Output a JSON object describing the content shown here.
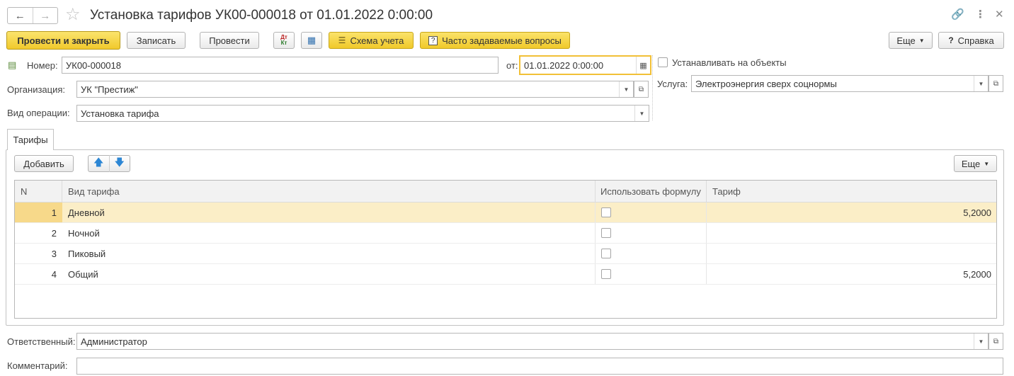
{
  "window": {
    "title": "Установка тарифов УК00-000018 от 01.01.2022 0:00:00"
  },
  "toolbar": {
    "post_close": "Провести и закрыть",
    "save": "Записать",
    "post": "Провести",
    "dt_kt_icon_label": "Дт Кт",
    "scheme": "Схема учета",
    "faq": "Часто задаваемые вопросы",
    "more": "Еще",
    "help": "Справка"
  },
  "form": {
    "number_label": "Номер:",
    "number_value": "УК00-000018",
    "date_label": "от:",
    "date_value": "01.01.2022  0:00:00",
    "org_label": "Организация:",
    "org_value": "УК \"Престиж\"",
    "op_label": "Вид операции:",
    "op_value": "Установка тарифа",
    "apply_objects_label": "Устанавливать на объекты",
    "service_label": "Услуга:",
    "service_value": "Электроэнергия сверх соцнормы",
    "responsible_label": "Ответственный:",
    "responsible_value": "Администратор",
    "comment_label": "Комментарий:",
    "comment_value": ""
  },
  "tabs": {
    "tariffs": "Тарифы"
  },
  "table_toolbar": {
    "add": "Добавить",
    "more": "Еще"
  },
  "table": {
    "headers": {
      "n": "N",
      "kind": "Вид тарифа",
      "formula": "Использовать формулу",
      "tariff": "Тариф"
    },
    "rows": [
      {
        "n": "1",
        "kind": "Дневной",
        "formula": false,
        "tariff": "5,2000"
      },
      {
        "n": "2",
        "kind": "Ночной",
        "formula": false,
        "tariff": ""
      },
      {
        "n": "3",
        "kind": "Пиковый",
        "formula": false,
        "tariff": ""
      },
      {
        "n": "4",
        "kind": "Общий",
        "formula": false,
        "tariff": "5,2000"
      }
    ]
  },
  "colors": {
    "accent_yellow": "#f1c92c",
    "selected_row": "#fbeec7",
    "focus_border": "#f2c037"
  }
}
